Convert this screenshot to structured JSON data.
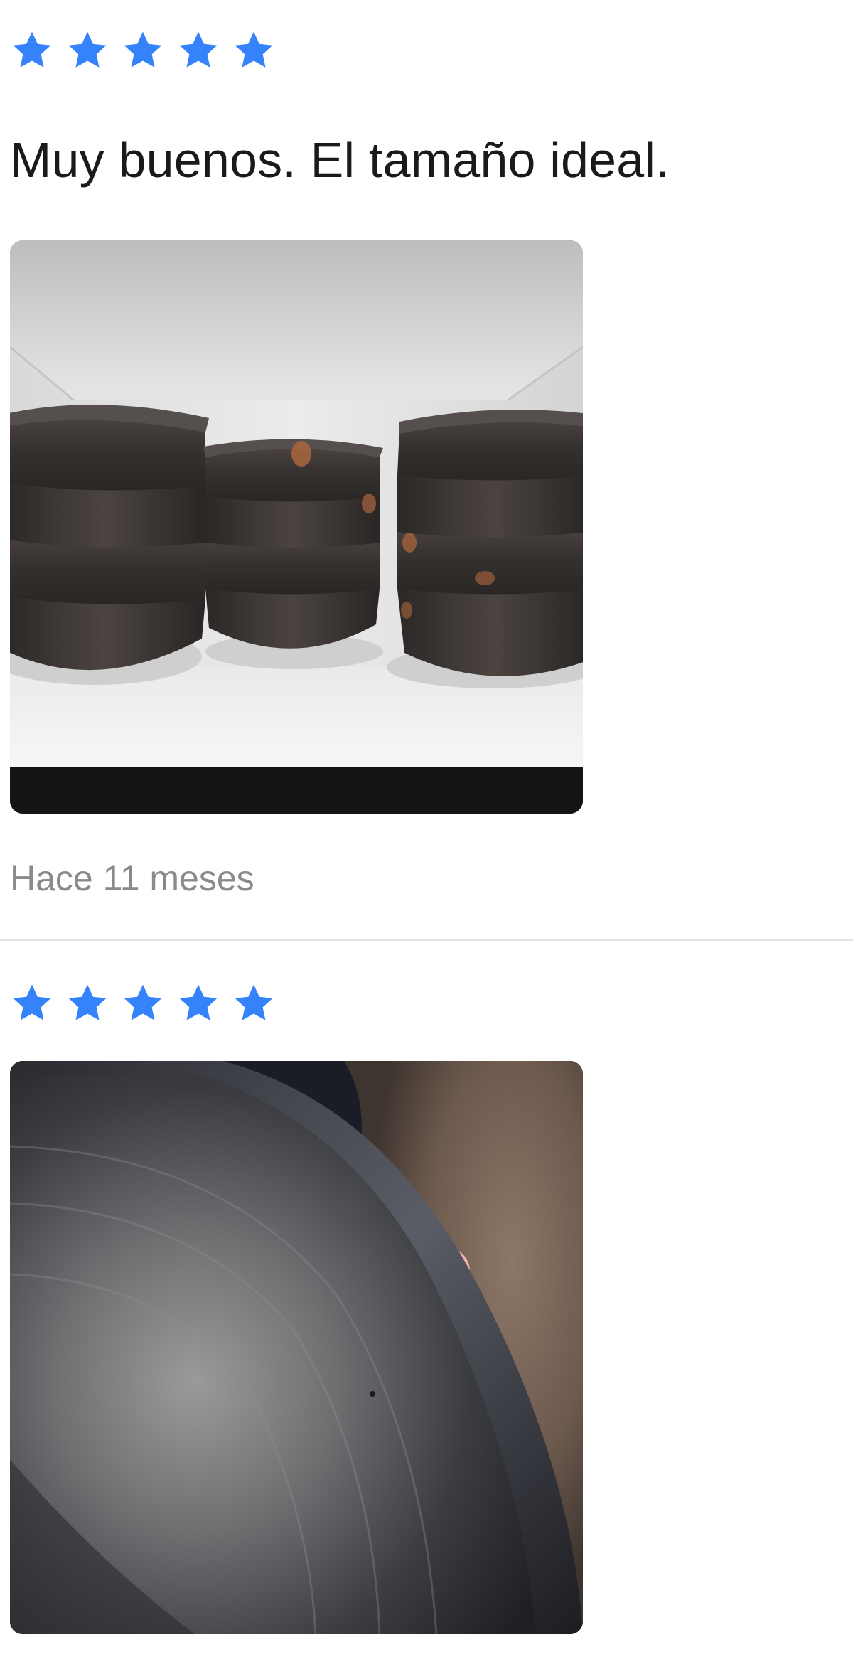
{
  "colors": {
    "star": "#3483FA",
    "text": "#1A1A1A",
    "muted": "#8A8A8A",
    "divider": "#E4E4E4"
  },
  "reviews": [
    {
      "rating": 5,
      "rating_icon": "star-icon",
      "text": "Muy buenos. El tamaño ideal.",
      "time": "Hace 11 meses"
    },
    {
      "rating": 5,
      "rating_icon": "star-icon"
    }
  ]
}
